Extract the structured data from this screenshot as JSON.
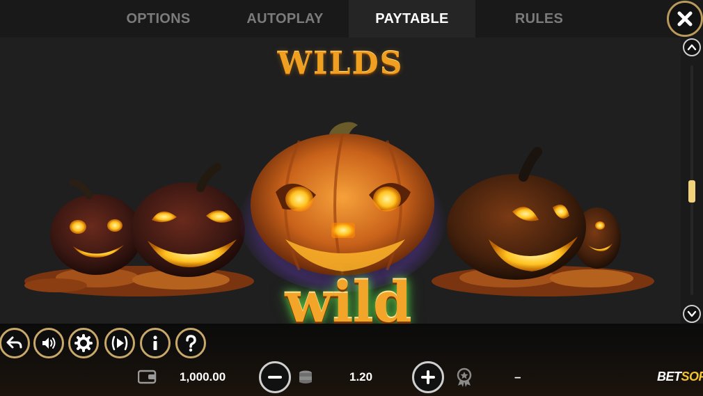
{
  "tabs": [
    {
      "label": "OPTIONS",
      "active": false
    },
    {
      "label": "AUTOPLAY",
      "active": false
    },
    {
      "label": "PAYTABLE",
      "active": true
    },
    {
      "label": "RULES",
      "active": false
    }
  ],
  "paytable": {
    "section_title": "WILDS",
    "symbol_label": "wild"
  },
  "status": {
    "balance": "1,000.00",
    "bet": "1.20",
    "win": "–"
  },
  "brand": {
    "part1": "BET",
    "part2": "SOFT"
  },
  "controls": [
    "back-icon",
    "sound-icon",
    "settings-icon",
    "autoplay-icon",
    "info-icon",
    "help-icon"
  ],
  "colors": {
    "accent_gold": "#c8a96a",
    "title_orange": "#f0a020",
    "scroll_thumb": "#f2d27a",
    "brand_yellow": "#f2c230"
  }
}
